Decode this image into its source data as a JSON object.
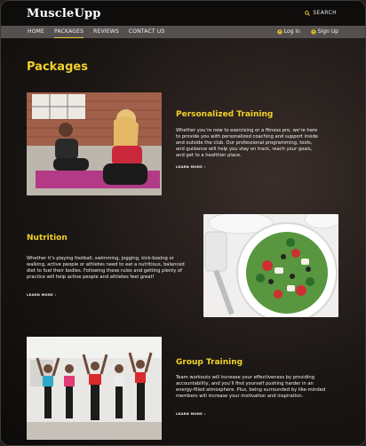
{
  "brand": "MuscleUpp",
  "header": {
    "search_label": "SEARCH"
  },
  "nav": {
    "items": [
      "HOME",
      "PACKAGES",
      "REVIEWS",
      "CONTACT US"
    ],
    "login": "Log in",
    "signup": "Sign Up"
  },
  "page": {
    "title": "Packages"
  },
  "sections": [
    {
      "title": "Personalized Training",
      "text": "Whether you’re new to exercising or a fitness pro, we’re here to provide you with personalized coaching and support inside and outside the club. Our professional programming, tools, and guidance will help you stay on track, reach your goals, and get to a healthier place.",
      "link": "LEARN MORE"
    },
    {
      "title": "Nutrition",
      "text": "Whether it’s playing football, swimming, jogging, kick-boxing or walking, active people or athletes need to eat a nutritious, balanced diet to fuel their bodies. Following these rules and getting plenty of practice will help active people and athletes feel great!",
      "link": "LEARN MORE"
    },
    {
      "title": "Group Training",
      "text": "Team workouts will increase your effectiveness by providing accountability, and you’ll find yourself pushing harder in an energy-filled atmosphere. Plus, being surrounded by like-minded members will increase your motivation and inspiration.",
      "link": "LEARN MORE"
    }
  ],
  "colors": {
    "accent": "#f2d128",
    "nav_bg": "#55504f",
    "topbar_bg": "#0f0d0c"
  },
  "icons": {
    "search": "search-icon",
    "login": "user-icon",
    "signup": "user-plus-icon",
    "link_arrow": "arrow-right-icon"
  }
}
